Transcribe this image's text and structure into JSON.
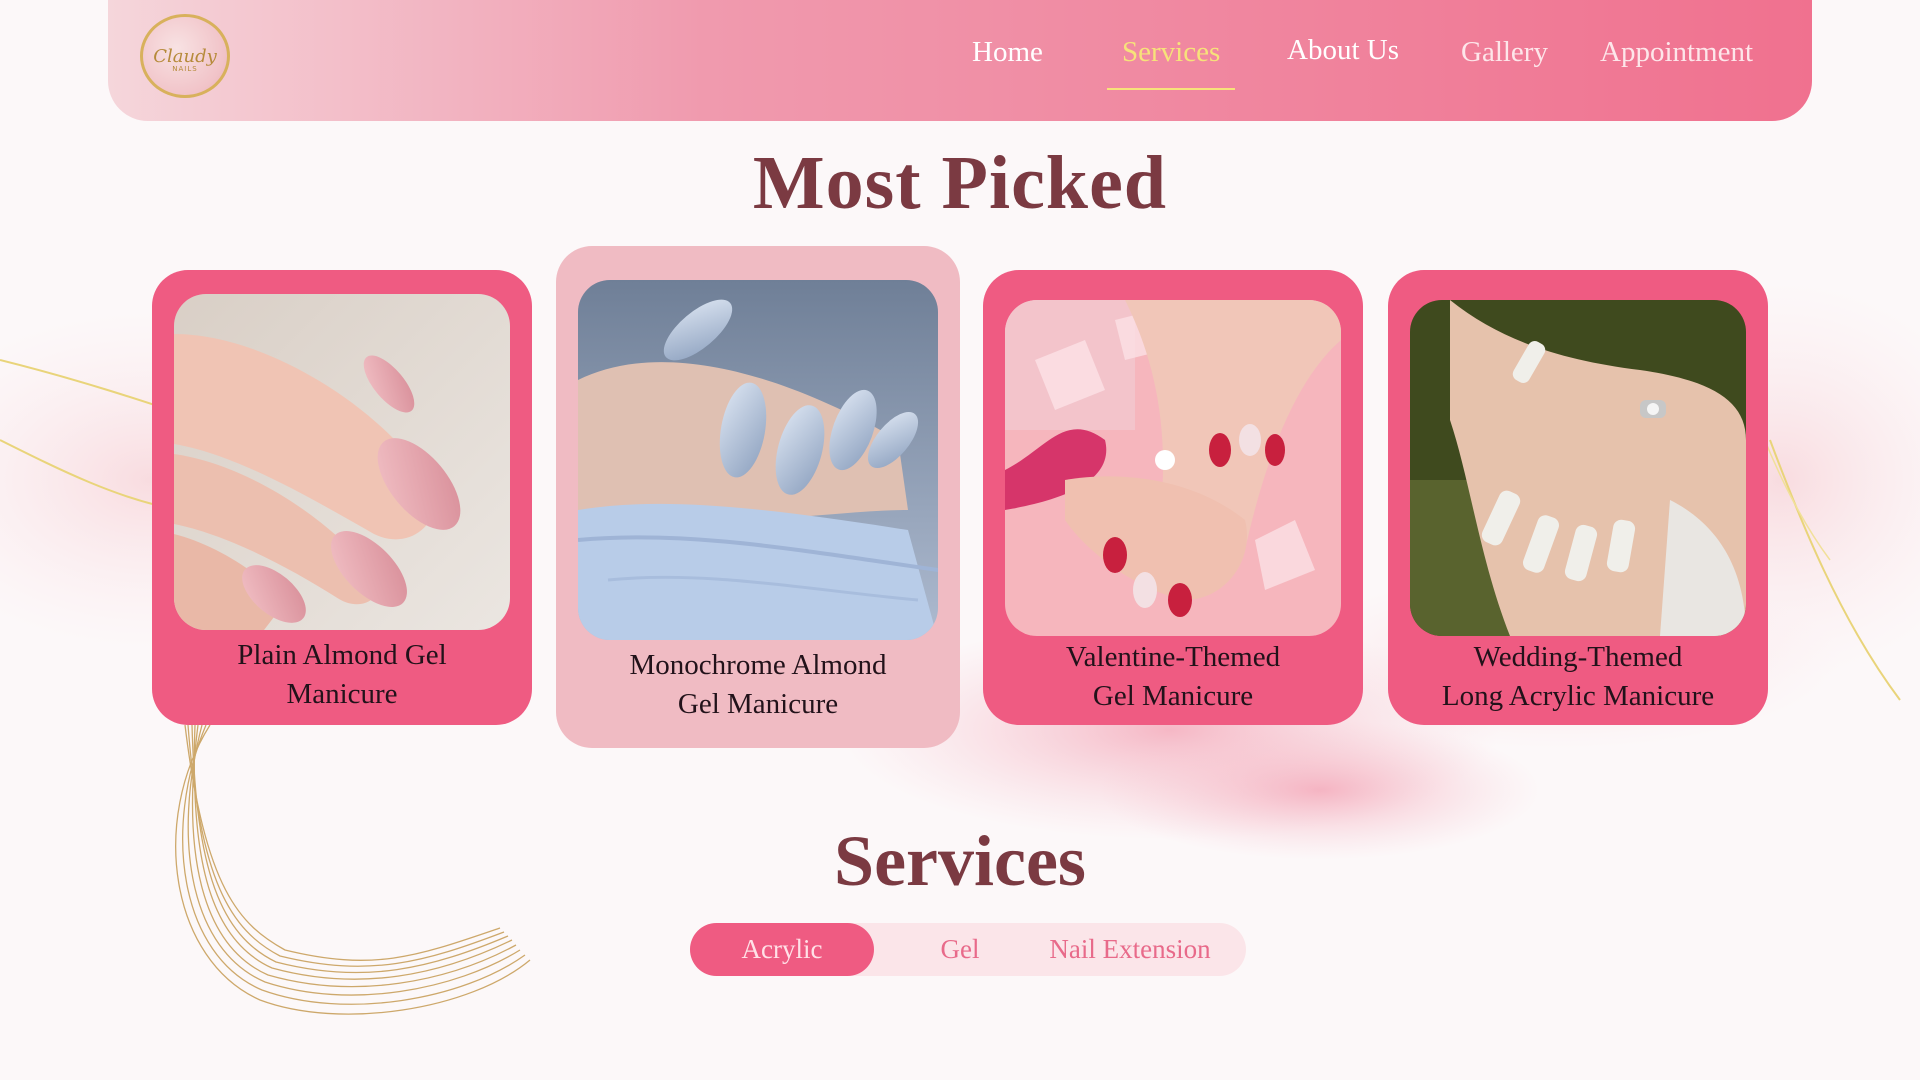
{
  "header": {
    "logo_text": "Claudy",
    "logo_sub": "NAILS",
    "nav": [
      {
        "label": "Home"
      },
      {
        "label": "Services"
      },
      {
        "label": "About Us"
      },
      {
        "label": "Gallery"
      },
      {
        "label": "Appointment"
      }
    ],
    "active_nav": "Services"
  },
  "most_picked": {
    "title": "Most Picked",
    "cards": [
      {
        "line1": "Plain Almond Gel",
        "line2": "Manicure"
      },
      {
        "line1": "Monochrome Almond",
        "line2": "Gel Manicure"
      },
      {
        "line1": "Valentine-Themed",
        "line2": "Gel Manicure"
      },
      {
        "line1": "Wedding-Themed",
        "line2": "Long Acrylic Manicure"
      }
    ]
  },
  "services": {
    "title": "Services",
    "tabs": [
      {
        "label": "Acrylic"
      },
      {
        "label": "Gel"
      },
      {
        "label": "Nail Extension"
      }
    ],
    "active_tab": "Acrylic"
  },
  "colors": {
    "header_start": "#f5d6db",
    "header_end": "#f0718f",
    "card": "#ef5b82",
    "card_featured": "#f0bbc3",
    "title": "#7b3a42",
    "active_nav": "#f7e27a"
  }
}
